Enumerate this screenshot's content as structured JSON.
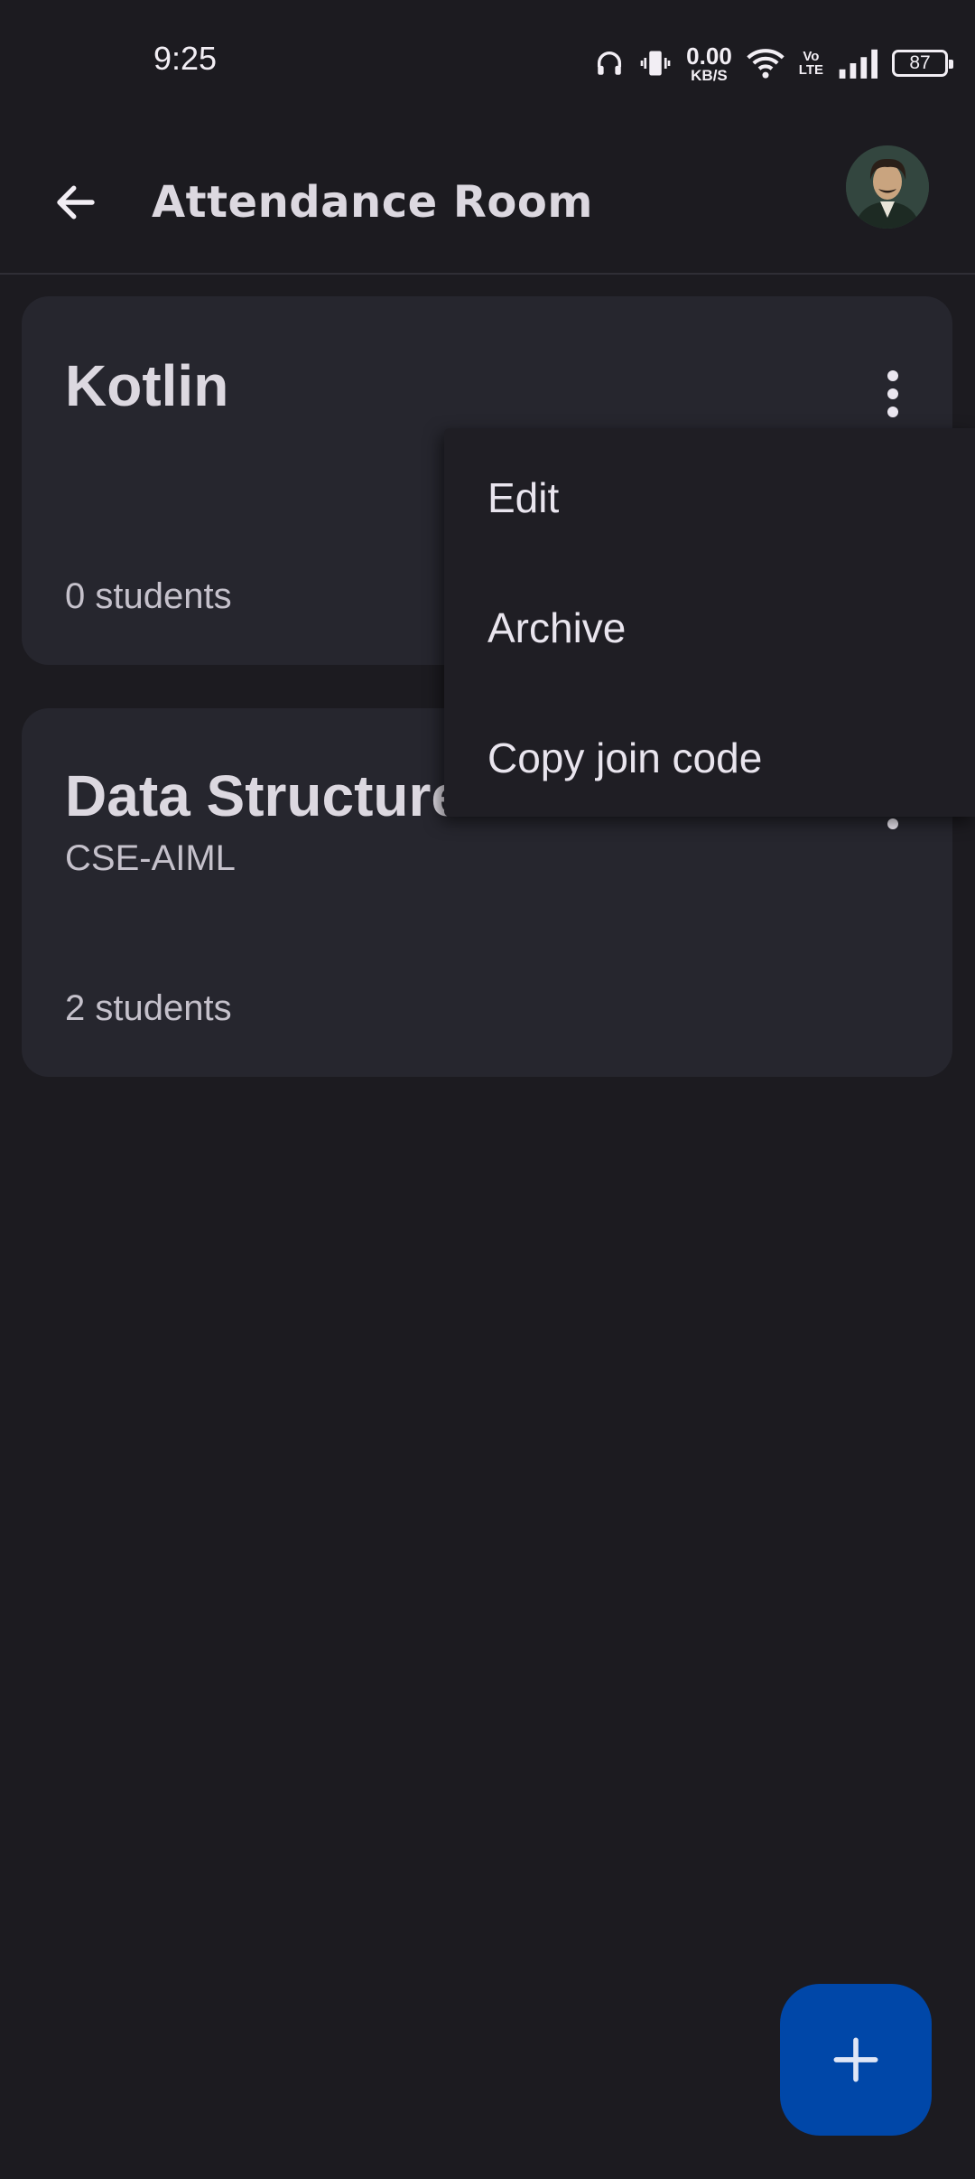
{
  "status_bar": {
    "time": "9:25",
    "net_speed_value": "0.00",
    "net_speed_unit": "KB/S",
    "volte_top": "Vo",
    "volte_bottom": "LTE",
    "battery": "87",
    "icons": [
      "headphones-icon",
      "vibrate-icon",
      "wifi-icon",
      "signal-icon",
      "battery-icon"
    ]
  },
  "app_bar": {
    "title": "Attendance Room",
    "back_icon": "arrow-back-icon",
    "avatar": "profile-avatar"
  },
  "classes": [
    {
      "title": "Kotlin",
      "subtitle": "",
      "students": "0 students"
    },
    {
      "title": "Data Structures",
      "subtitle": "CSE-AIML",
      "students": "2 students"
    }
  ],
  "menu": {
    "items": [
      "Edit",
      "Archive",
      "Copy join code"
    ]
  },
  "fab": {
    "icon": "add-icon"
  },
  "colors": {
    "background": "#1c1b20",
    "card": "#26262e",
    "fab": "#0047a8"
  }
}
